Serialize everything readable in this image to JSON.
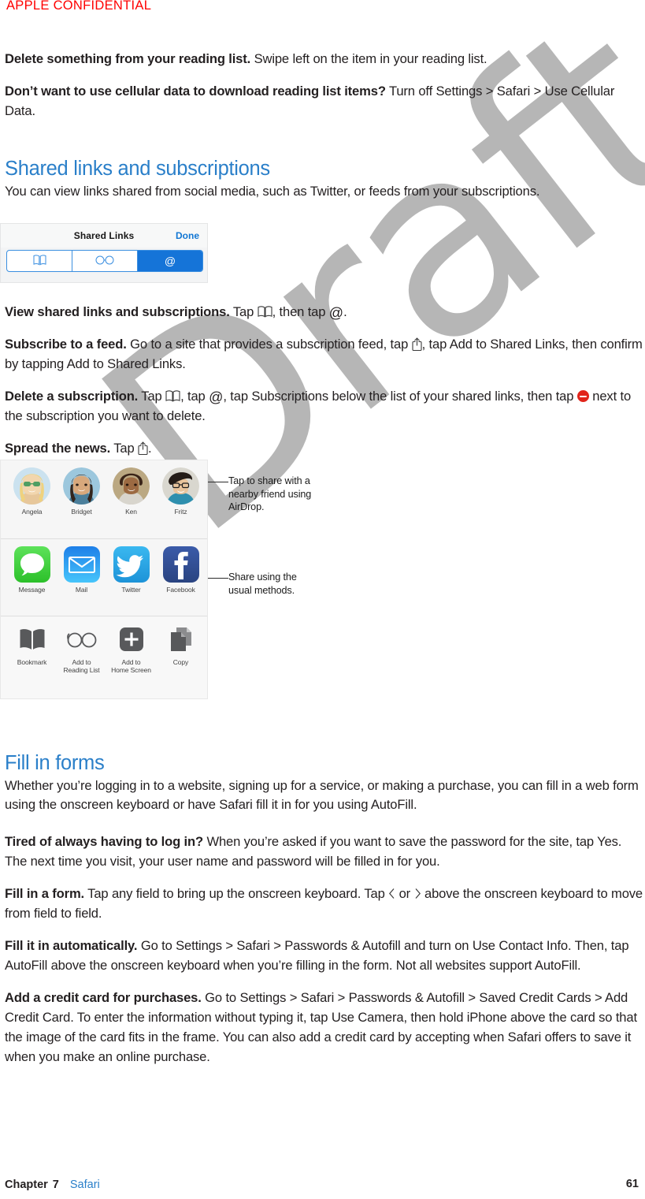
{
  "confidential_banner": "APPLE CONFIDENTIAL",
  "watermark": "Draft",
  "colors": {
    "heading_blue": "#2a7fc9",
    "link_blue": "#2a7fc9",
    "confidential_red": "#ff0000",
    "watermark_gray": "#b6b6b6",
    "body_text": "#231f20",
    "ios_blue": "#1574d8",
    "delete_red": "#e1251b"
  },
  "top_paragraphs": [
    {
      "lead": "Delete something from your reading list.",
      "body": " Swipe left on the item in your reading list."
    },
    {
      "lead": "Don’t want to use cellular data to download reading list items?",
      "body": " Turn off Settings > Safari > Use Cellular Data."
    }
  ],
  "section_shared_links": {
    "heading": "Shared links and subscriptions",
    "intro": "You can view links shared from social media, such as Twitter, or feeds from your subscriptions.",
    "figure": {
      "name": "shared-links-toolbar",
      "title": "Shared Links",
      "done_label": "Done",
      "segments": [
        {
          "icon": "bookmarks-icon",
          "active": false
        },
        {
          "icon": "reading-list-glasses-icon",
          "active": false
        },
        {
          "icon": "at-sign-icon",
          "active": true
        }
      ]
    },
    "paragraphs": [
      {
        "lead": "View shared links and subscriptions.",
        "parts": [
          {
            "t": "text",
            "v": " Tap "
          },
          {
            "t": "icon",
            "v": "bookmarks-icon"
          },
          {
            "t": "text",
            "v": ", then tap "
          },
          {
            "t": "icon",
            "v": "at-sign-icon"
          },
          {
            "t": "text",
            "v": "."
          }
        ]
      },
      {
        "lead": "Subscribe to a feed.",
        "parts": [
          {
            "t": "text",
            "v": " Go to a site that provides a subscription feed, tap "
          },
          {
            "t": "icon",
            "v": "share-icon"
          },
          {
            "t": "text",
            "v": ", tap Add to Shared Links, then confirm by tapping Add to Shared Links."
          }
        ]
      },
      {
        "lead": "Delete a subscription.",
        "parts": [
          {
            "t": "text",
            "v": " Tap "
          },
          {
            "t": "icon",
            "v": "bookmarks-icon"
          },
          {
            "t": "text",
            "v": ", tap "
          },
          {
            "t": "icon",
            "v": "at-sign-icon"
          },
          {
            "t": "text",
            "v": ", tap Subscriptions below the list of your shared links, then tap "
          },
          {
            "t": "icon",
            "v": "delete-minus-icon"
          },
          {
            "t": "text",
            "v": " next to the subscription you want to delete."
          }
        ]
      },
      {
        "lead": "Spread the news.",
        "parts": [
          {
            "t": "text",
            "v": " Tap "
          },
          {
            "t": "icon",
            "v": "share-icon"
          },
          {
            "t": "text",
            "v": "."
          }
        ]
      }
    ]
  },
  "share_sheet": {
    "name": "share-sheet-figure",
    "rows": [
      {
        "kind": "airdrop-contacts",
        "items": [
          {
            "label": "Angela",
            "icon": "avatar-angela"
          },
          {
            "label": "Bridget",
            "icon": "avatar-bridget"
          },
          {
            "label": "Ken",
            "icon": "avatar-ken"
          },
          {
            "label": "Fritz",
            "icon": "avatar-fritz"
          }
        ]
      },
      {
        "kind": "share-apps",
        "items": [
          {
            "label": "Message",
            "icon": "messages-app-icon"
          },
          {
            "label": "Mail",
            "icon": "mail-app-icon"
          },
          {
            "label": "Twitter",
            "icon": "twitter-app-icon"
          },
          {
            "label": "Facebook",
            "icon": "facebook-app-icon"
          }
        ]
      },
      {
        "kind": "actions",
        "items": [
          {
            "label": "Bookmark",
            "icon": "bookmark-action-icon"
          },
          {
            "label": "Add to\nReading List",
            "icon": "reading-list-action-icon"
          },
          {
            "label": "Add to\nHome Screen",
            "icon": "add-home-screen-action-icon"
          },
          {
            "label": "Copy",
            "icon": "copy-action-icon"
          }
        ]
      }
    ],
    "callouts": [
      {
        "name": "callout-airdrop",
        "text": "Tap to share with a nearby friend using AirDrop."
      },
      {
        "name": "callout-share-methods",
        "text": "Share using the usual methods."
      }
    ]
  },
  "section_fill_forms": {
    "heading": "Fill in forms",
    "intro": "Whether you’re logging in to a website, signing up for a service, or making a purchase, you can fill in a web form using the onscreen keyboard or have Safari fill it in for you using AutoFill.",
    "paragraphs": [
      {
        "lead": "Tired of always having to log in?",
        "parts": [
          {
            "t": "text",
            "v": " When you’re asked if you want to save the password for the site, tap Yes. The next time you visit, your user name and password will be filled in for you."
          }
        ]
      },
      {
        "lead": "Fill in a form.",
        "parts": [
          {
            "t": "text",
            "v": " Tap any field to bring up the onscreen keyboard. Tap "
          },
          {
            "t": "icon",
            "v": "chevron-left-icon"
          },
          {
            "t": "text",
            "v": " or "
          },
          {
            "t": "icon",
            "v": "chevron-right-icon"
          },
          {
            "t": "text",
            "v": " above the onscreen keyboard to move from field to field."
          }
        ]
      },
      {
        "lead": "Fill it in automatically.",
        "parts": [
          {
            "t": "text",
            "v": " Go to Settings > Safari > Passwords & Autofill and turn on Use Contact Info. Then, tap AutoFill above the onscreen keyboard when you’re filling in the form. Not all websites support AutoFill."
          }
        ]
      },
      {
        "lead": "Add a credit card for purchases.",
        "parts": [
          {
            "t": "text",
            "v": " Go to Settings > Safari > Passwords & Autofill > Saved Credit Cards > Add Credit Card. To enter the information without typing it, tap Use Camera, then hold iPhone above the card so that the image of the card fits in the frame. You can also add a credit card by accepting when Safari offers to save it when you make an online purchase."
          }
        ]
      }
    ]
  },
  "footer": {
    "chapter_label": "Chapter",
    "chapter_number": "7",
    "chapter_title": "Safari",
    "page_number": "61"
  }
}
